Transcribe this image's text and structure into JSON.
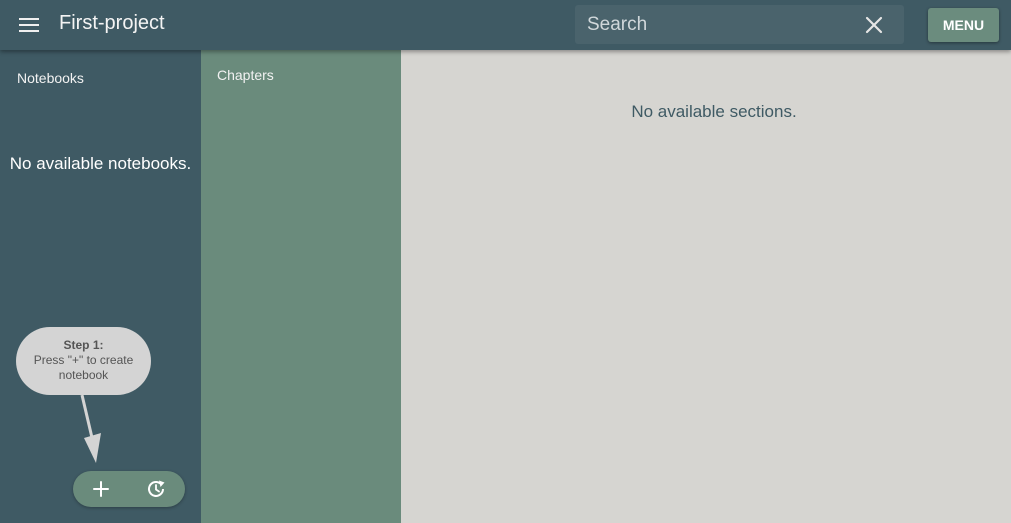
{
  "app": {
    "title": "First-project"
  },
  "header": {
    "menu_icon": "hamburger-icon",
    "search": {
      "placeholder": "Search",
      "value": ""
    },
    "clear_icon": "close-icon",
    "menu_button_label": "MENU"
  },
  "notebooks": {
    "label": "Notebooks",
    "empty_message": "No available notebooks."
  },
  "chapters": {
    "label": "Chapters"
  },
  "sections": {
    "empty_message": "No available sections."
  },
  "tooltip": {
    "title": "Step 1:",
    "text": "Press \"+\" to create notebook"
  },
  "fab": {
    "add_icon": "plus-icon",
    "history_icon": "history-icon"
  },
  "colors": {
    "toolbar": "#3f5a64",
    "notebooks_pane": "#3f5a64",
    "chapters_pane": "#6a8b7c",
    "sections_pane": "#d6d5d1",
    "accent": "#6b8c7e"
  }
}
